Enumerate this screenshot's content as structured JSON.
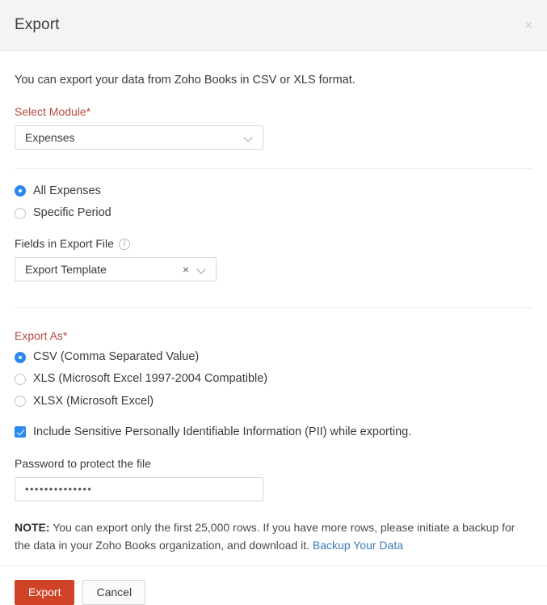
{
  "header": {
    "title": "Export",
    "close_label": "×"
  },
  "body": {
    "intro_text": "You can export your data from Zoho Books in CSV or XLS format.",
    "select_module": {
      "label": "Select Module*",
      "value": "Expenses"
    },
    "scope": {
      "options": [
        {
          "label": "All Expenses",
          "selected": true
        },
        {
          "label": "Specific Period",
          "selected": false
        }
      ]
    },
    "fields_in_export": {
      "label": "Fields in Export File",
      "info_icon_glyph": "i",
      "value": "Export Template",
      "clear_glyph": "×"
    },
    "export_as": {
      "label": "Export As*",
      "options": [
        {
          "label": "CSV (Comma Separated Value)",
          "selected": true
        },
        {
          "label": "XLS (Microsoft Excel 1997-2004 Compatible)",
          "selected": false
        },
        {
          "label": "XLSX (Microsoft Excel)",
          "selected": false
        }
      ]
    },
    "include_pii": {
      "label": "Include Sensitive Personally Identifiable Information (PII) while exporting.",
      "checked": true
    },
    "password": {
      "label": "Password to protect the file",
      "value": "••••••••••••••",
      "placeholder": ""
    },
    "note": {
      "prefix": "NOTE:",
      "text": "You can export only the first 25,000 rows. If you have more rows, please initiate a backup for the data in your Zoho Books organization, and download it.",
      "link_text": "Backup Your Data"
    }
  },
  "footer": {
    "export_label": "Export",
    "cancel_label": "Cancel"
  },
  "colors": {
    "accent_blue": "#2b8aed",
    "primary_button": "#d04327",
    "required_label": "#b84a40",
    "link": "#4079bd",
    "header_bg": "#f4f4f4"
  }
}
